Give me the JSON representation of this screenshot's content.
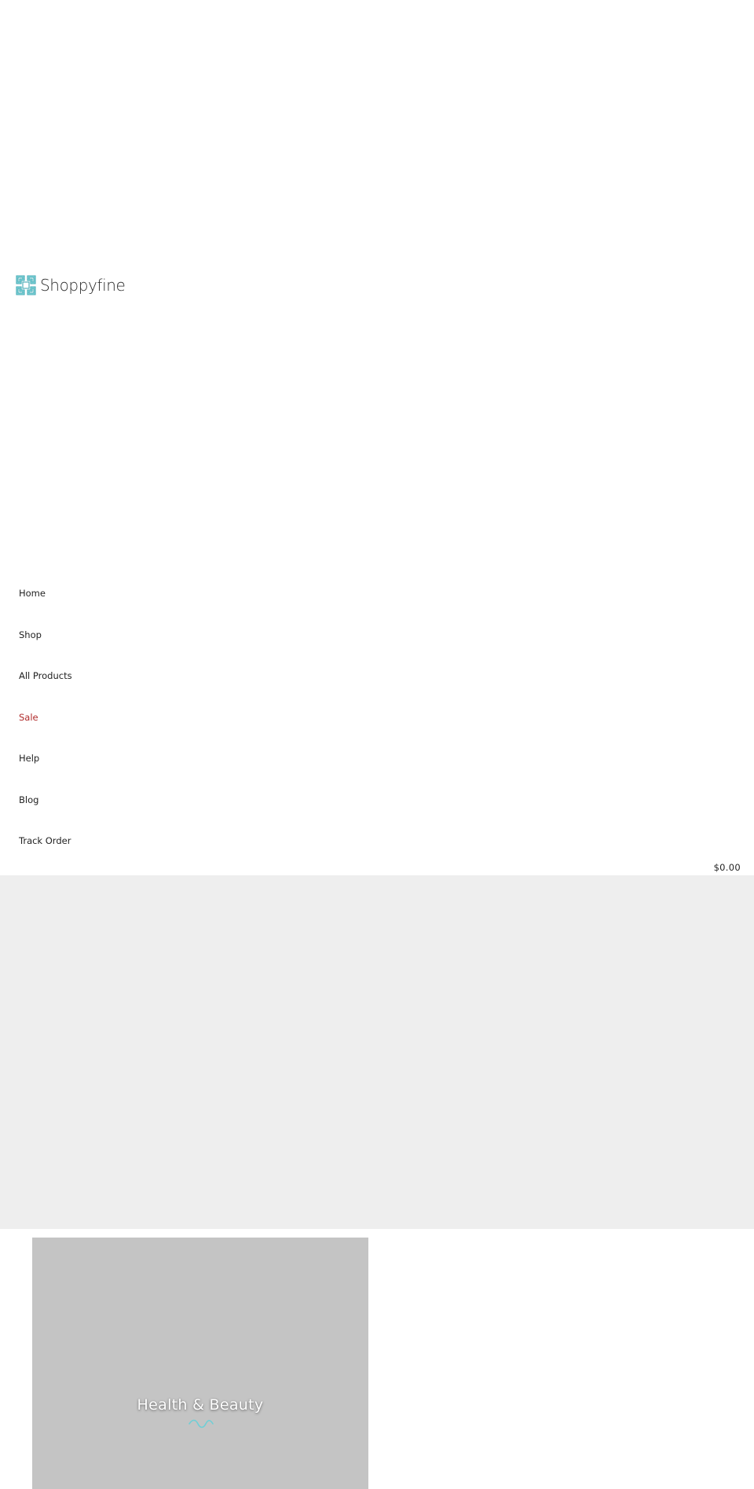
{
  "colors": {
    "brand_teal": "#6fcfd6",
    "brand_teal_dark": "#44aab4",
    "sale_red": "#b02b2b",
    "hero_bg": "#eeeeee",
    "card_bg": "#c4c4c4"
  },
  "header": {
    "logo_text": "Shoppyfine",
    "logo_icon": "logo-mark-icon",
    "cart_total": "$0.00"
  },
  "nav": {
    "items": [
      {
        "label": "Home"
      },
      {
        "label": "Shop"
      },
      {
        "label": "All Products"
      },
      {
        "label": "Sale"
      },
      {
        "label": "Help"
      },
      {
        "label": "Blog"
      },
      {
        "label": "Track Order"
      }
    ]
  },
  "categories": [
    {
      "title": "Health & Beauty",
      "icon": "squiggle-icon"
    }
  ]
}
